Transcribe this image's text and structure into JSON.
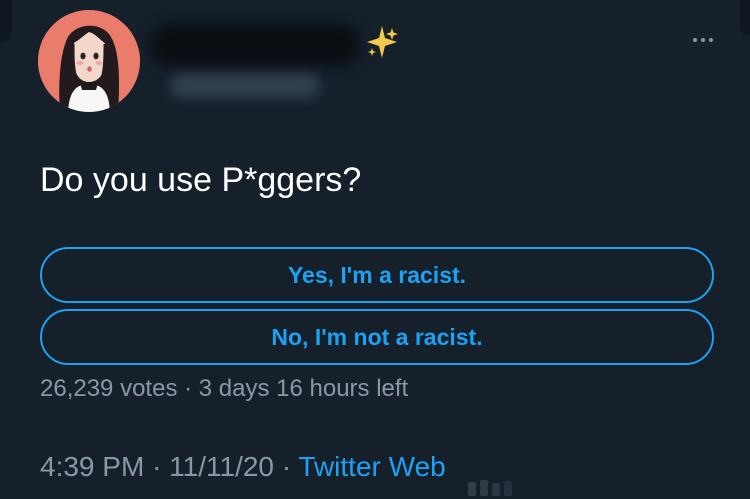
{
  "tweet": {
    "text": "Do you use P*ggers?"
  },
  "poll": {
    "options": [
      {
        "label": "Yes, I'm a racist."
      },
      {
        "label": "No, I'm not a racist."
      }
    ],
    "meta": "26,239 votes · 3 days 16 hours left"
  },
  "footer": {
    "time": "4:39 PM",
    "separator": "·",
    "date": "11/11/20",
    "source": "Twitter Web"
  },
  "icons": {
    "sparkles": "sparkles-icon",
    "more": "more-icon",
    "avatar": "avatar"
  },
  "colors": {
    "background": "#15202b",
    "accent": "#1da1f2",
    "secondary_text": "#8899a6",
    "primary_text": "#ffffff",
    "avatar_bg": "#ea7c6b"
  }
}
